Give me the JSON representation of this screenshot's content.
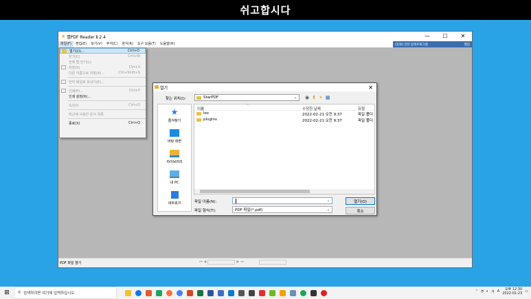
{
  "banner": {
    "text": "쉬고합시다"
  },
  "window": {
    "title": "별PDF Reader Ⅱ 2.4",
    "controls": [
      "—",
      "☐",
      "✕"
    ],
    "menu": [
      "파일(F)",
      "편집(E)",
      "보기(V)",
      "주석(C)",
      "양식(R)",
      "도구 모음(T)",
      "도움말(H)"
    ],
    "promo": "[강좌] 안전 압축프로그램",
    "promo_right": "별집",
    "status": "PDF 파일 열기"
  },
  "file_menu": [
    {
      "label": "열기(O)...",
      "shortcut": "Ctrl+O",
      "disabled": false,
      "highlight": true
    },
    {
      "label": "닫기(C)",
      "shortcut": "Ctrl+W",
      "disabled": true
    },
    {
      "label": "전체 탭 닫기(L)",
      "shortcut": "",
      "disabled": true
    },
    {
      "label": "저장(S)",
      "shortcut": "Ctrl+S",
      "disabled": true
    },
    {
      "label": "다른 이름으로 저장(A)...",
      "shortcut": "Ctrl+Shift+S",
      "disabled": true
    },
    {
      "label": "전자 메일로 보내기(E)...",
      "shortcut": "",
      "disabled": true
    },
    {
      "label": "인쇄(P)...",
      "shortcut": "Ctrl+P",
      "disabled": true
    },
    {
      "label": "인쇄 설정(R)...",
      "shortcut": "",
      "disabled": false
    },
    {
      "label": "속성(I)",
      "shortcut": "Ctrl+D",
      "disabled": true
    },
    {
      "label": "최근에 사용한 문서 목록",
      "shortcut": "",
      "disabled": true
    },
    {
      "label": "종료(X)",
      "shortcut": "Ctrl+Q",
      "disabled": false
    }
  ],
  "dialog": {
    "title": "열기",
    "look_in_label": "찾는 위치(I):",
    "look_in_value": "StarPDF",
    "places": [
      "즐겨찾기",
      "바탕 화면",
      "라이브러리",
      "내 PC",
      "네트워크"
    ],
    "columns": [
      "이름",
      "수정한 날짜",
      "유형"
    ],
    "files": [
      {
        "name": "lex",
        "date": "2022-02-21 오전 9:37",
        "type": "파일 폴더"
      },
      {
        "name": "plugins",
        "date": "2022-02-21 오전 9:37",
        "type": "파일 폴더"
      }
    ],
    "filename_label": "파일 이름(N):",
    "filename_value": "",
    "filetype_label": "파일 형식(T):",
    "filetype_value": "PDF 파일(*.pdf)",
    "open_button": "열기(O)",
    "cancel_button": "취소"
  },
  "taskbar": {
    "search_placeholder": "검색하려면 여기에 입력하십시오.",
    "ime": "가",
    "lang": "A",
    "time": "오후 12:30",
    "date": "2022-01-23"
  }
}
